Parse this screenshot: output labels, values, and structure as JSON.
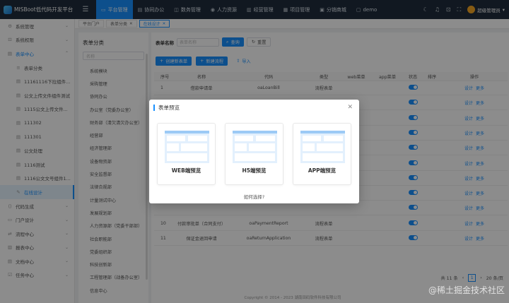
{
  "app": {
    "title": "MISBoot低代码开发平台"
  },
  "topnav": {
    "items": [
      {
        "label": "平台管理",
        "icon": "desktop-icon",
        "active": true
      },
      {
        "label": "协同办公",
        "icon": "doc-icon"
      },
      {
        "label": "数务管理",
        "icon": "db-icon"
      },
      {
        "label": "人力资源",
        "icon": "person-icon"
      },
      {
        "label": "经营管理",
        "icon": "chart-icon"
      },
      {
        "label": "项目管理",
        "icon": "folder-icon"
      },
      {
        "label": "分销商城",
        "icon": "shop-icon"
      },
      {
        "label": "demo",
        "icon": "demo-icon"
      }
    ],
    "user": "超级管理员"
  },
  "sidebar": {
    "items": [
      {
        "label": "系统管理",
        "icon": "gear-icon",
        "level": 1,
        "state": ""
      },
      {
        "label": "系统权限",
        "icon": "lock-icon",
        "level": 1,
        "state": ""
      },
      {
        "label": "表单中心",
        "icon": "form-icon",
        "level": 1,
        "state": "open"
      },
      {
        "label": "表单分类",
        "icon": "list-icon",
        "level": 2,
        "state": ""
      },
      {
        "label": "11161116下拉组件...",
        "icon": "form-icon",
        "level": 2,
        "state": ""
      },
      {
        "label": "公文上传文件组件测试",
        "icon": "form-icon",
        "level": 2,
        "state": ""
      },
      {
        "label": "1115公文上传文件...",
        "icon": "form-icon",
        "level": 2,
        "state": ""
      },
      {
        "label": "111302",
        "icon": "form-icon",
        "level": 2,
        "state": ""
      },
      {
        "label": "111301",
        "icon": "form-icon",
        "level": 2,
        "state": ""
      },
      {
        "label": "公文处理",
        "icon": "form-icon",
        "level": 2,
        "state": ""
      },
      {
        "label": "1116测试",
        "icon": "form-icon",
        "level": 2,
        "state": ""
      },
      {
        "label": "1116公文文号组件1...",
        "icon": "form-icon",
        "level": 2,
        "state": ""
      },
      {
        "label": "在线设计",
        "icon": "design-icon",
        "level": 2,
        "state": "active"
      },
      {
        "label": "代码生成",
        "icon": "code-icon",
        "level": 1,
        "state": ""
      },
      {
        "label": "门户设计",
        "icon": "portal-icon",
        "level": 1,
        "state": ""
      },
      {
        "label": "流程中心",
        "icon": "flow-icon",
        "level": 1,
        "state": ""
      },
      {
        "label": "报表中心",
        "icon": "report-icon",
        "level": 1,
        "state": ""
      },
      {
        "label": "文档中心",
        "icon": "doc-icon",
        "level": 1,
        "state": ""
      },
      {
        "label": "任务中心",
        "icon": "task-icon",
        "level": 1,
        "state": ""
      }
    ]
  },
  "tabs": [
    {
      "label": "平台门户",
      "closable": false,
      "active": false
    },
    {
      "label": "表单分类",
      "closable": true,
      "active": false
    },
    {
      "label": "在线设计",
      "closable": true,
      "active": true
    }
  ],
  "category": {
    "title": "表单分类",
    "search_placeholder": "名称",
    "items": [
      "系统模块",
      "采购管理",
      "协同办公",
      "办公室（党委办公室）",
      "财务部（清欠清欠办公室）",
      "经营部",
      "经济管理部",
      "设备物资部",
      "安全监督部",
      "法律合规部",
      "计量测试中心",
      "发展规划部",
      "人力资源部（党委干部部）",
      "社会职能部",
      "党委组织部",
      "科技创新部",
      "工程管理部（战备办公室）",
      "信息中心"
    ]
  },
  "filter": {
    "label": "表单名称",
    "placeholder": "表单名称",
    "search": "查询",
    "reset": "重置"
  },
  "actions": {
    "create": "创建新表单",
    "new_flow": "新建流程",
    "import": "导入"
  },
  "table": {
    "headers": [
      "序号",
      "名称",
      "代码",
      "类型",
      "web菜单",
      "app菜单",
      "状态",
      "排序",
      "操作"
    ],
    "rows": [
      {
        "no": "1",
        "name": "借款申请单",
        "code": "oaLoanBill",
        "type": "流程表单"
      },
      {
        "no": "",
        "name": "",
        "code": "",
        "type": ""
      },
      {
        "no": "",
        "name": "",
        "code": "",
        "type": ""
      },
      {
        "no": "",
        "name": "",
        "code": "",
        "type": ""
      },
      {
        "no": "",
        "name": "",
        "code": "",
        "type": ""
      },
      {
        "no": "",
        "name": "",
        "code": "",
        "type": ""
      },
      {
        "no": "",
        "name": "",
        "code": "",
        "type": ""
      },
      {
        "no": "",
        "name": "",
        "code": "",
        "type": ""
      },
      {
        "no": "",
        "name": "",
        "code": "",
        "type": ""
      },
      {
        "no": "10",
        "name": "付款审批单（合同支付）",
        "code": "oaPaymentReport",
        "type": "流程表单"
      },
      {
        "no": "11",
        "name": "保证金退回申请",
        "code": "oaReturnApplication",
        "type": "流程表单"
      }
    ],
    "op_design": "设计",
    "op_more": "更多",
    "state_on": true
  },
  "pager": {
    "total": "共 11 条",
    "page": "1",
    "size": "20 条/页"
  },
  "footer": "Copyright © 2014 - 2023 湖南田码软件科技有限公司",
  "modal": {
    "title": "表单预览",
    "cards": [
      {
        "label": "WEB端预览"
      },
      {
        "label": "H5端预览"
      },
      {
        "label": "APP端预览"
      }
    ],
    "help": "如何选择?"
  },
  "watermark": "@稀土掘金技术社区",
  "colors": {
    "primary": "#1890ff",
    "topbar": "#1f2d3d"
  }
}
